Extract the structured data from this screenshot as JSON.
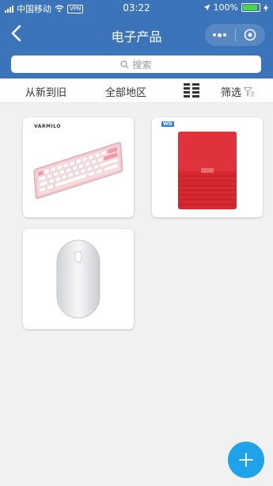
{
  "status_bar": {
    "carrier": "中国移动",
    "vpn": "VPN",
    "time": "03:22",
    "battery": "100%",
    "battery_level": 1.0
  },
  "nav": {
    "title": "电子产品"
  },
  "search": {
    "placeholder": "搜索"
  },
  "filters": {
    "sort_label": "从新到旧",
    "region_label": "全部地区",
    "filter_label": "筛选"
  },
  "products": [
    {
      "brand": "VARMILO",
      "icon": "pink-keyboard"
    },
    {
      "brand": "WD",
      "icon": "red-external-drive"
    },
    {
      "brand": "",
      "icon": "white-mouse"
    }
  ],
  "colors": {
    "header": "#3b74b8",
    "fab": "#1fa2ea",
    "background": "#f2f1f1"
  }
}
